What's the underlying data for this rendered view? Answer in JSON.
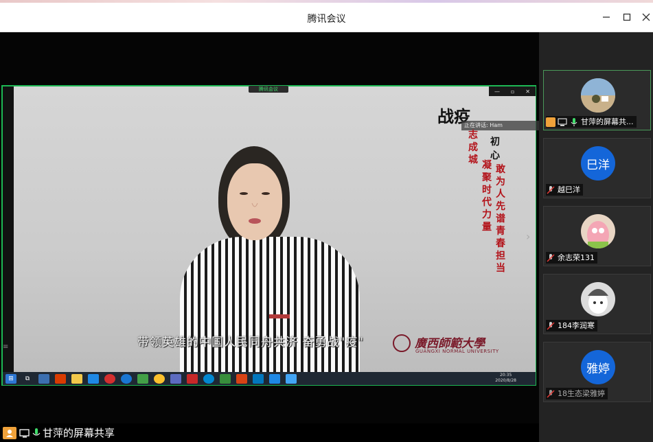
{
  "window": {
    "title": "腾讯会议",
    "minimize": "—",
    "maximize": "☐",
    "close": "✕"
  },
  "shared_screen": {
    "mini_title": "腾讯会议",
    "presenter_overlay": "正在讲话: Ham",
    "poster_title": "战疫",
    "poster_heart": "初心",
    "vertical_red_1": "凝聚时代力量",
    "vertical_red_0": "志成城",
    "vertical_red_2": "敢为人先谱青春担当",
    "subtitle": "带领英雄的中国人民同舟共济 奋勇战\"疫\"",
    "university_cn": "廣西師範大學",
    "university_en": "GUANGXI NORMAL UNIVERSITY",
    "clock_time": "20:35",
    "clock_date": "2020/8/28",
    "taskbar_icons": [
      "windows-start",
      "task-view",
      "app-1",
      "office",
      "explorer",
      "mail",
      "netease-music",
      "qq-browser",
      "iqiyi",
      "chrome",
      "vscode",
      "adobe",
      "edge",
      "player",
      "powerpoint",
      "app-2",
      "tencent-meeting",
      "app-3"
    ]
  },
  "participants": [
    {
      "name": "甘萍的屏幕共...",
      "avatar_text": "",
      "avatar_color": "#9fb7c6",
      "active": true
    },
    {
      "name": "越巳洋",
      "avatar_text": "巳洋",
      "avatar_color": "#1466d9",
      "active": false
    },
    {
      "name": "余志荣131",
      "avatar_text": "",
      "avatar_color": "#e8d5c4",
      "active": false
    },
    {
      "name": "184李润寒",
      "avatar_text": "",
      "avatar_color": "#dcdcdc",
      "active": false
    },
    {
      "name": "18生态梁雅婷",
      "avatar_text": "雅婷",
      "avatar_color": "#1466d9",
      "active": false
    }
  ],
  "bottom_label": "甘萍的屏幕共享",
  "colors": {
    "share_border": "#1db954",
    "accent_blue": "#1466d9",
    "me_orange": "#f0a23a"
  }
}
